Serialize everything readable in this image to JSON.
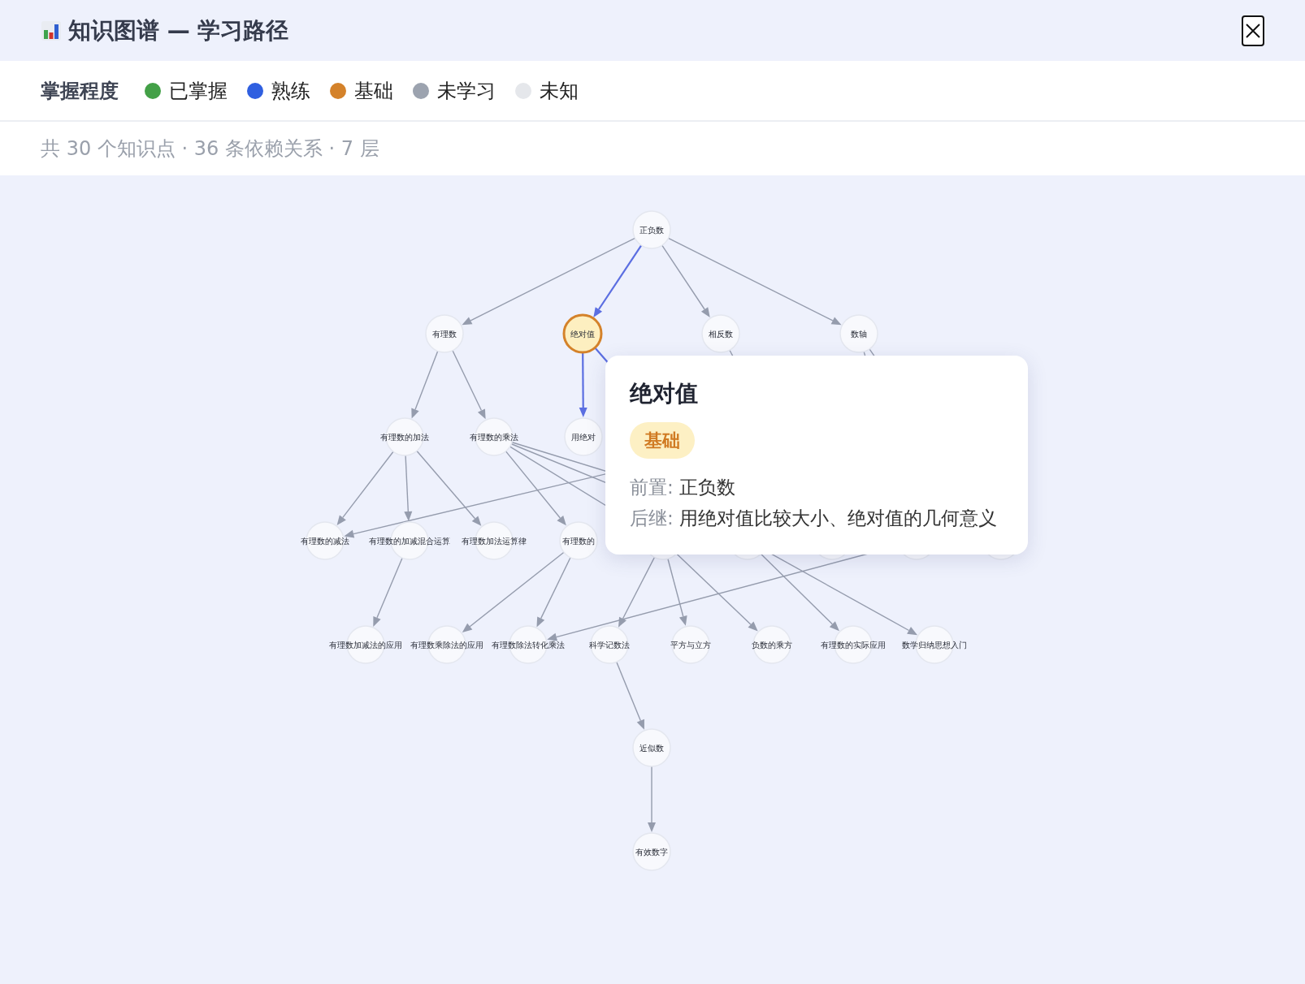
{
  "window": {
    "title": "知识图谱 — 学习路径"
  },
  "legend": {
    "title": "掌握程度",
    "items": [
      {
        "label": "已掌握",
        "color": "#43a047"
      },
      {
        "label": "熟练",
        "color": "#2f5fe0"
      },
      {
        "label": "基础",
        "color": "#d4822a"
      },
      {
        "label": "未学习",
        "color": "#9ca3af"
      },
      {
        "label": "未知",
        "color": "#e5e7eb"
      }
    ]
  },
  "stats": "共 30 个知识点 · 36 条依赖关系 · 7 层",
  "graph": {
    "layers": [
      {
        "nodes": [
          {
            "label": "正负数",
            "selected": false
          }
        ]
      },
      {
        "nodes": [
          {
            "label": "有理数",
            "selected": false
          },
          {
            "label": "绝对值",
            "selected": true
          },
          {
            "label": "相反数",
            "selected": false
          },
          {
            "label": "数轴",
            "selected": false
          }
        ]
      },
      {
        "nodes": [
          {
            "label": "有理数的加法",
            "selected": false
          },
          {
            "label": "有理数的乘法",
            "selected": false
          },
          {
            "label": "用绝对",
            "selected": false
          }
        ]
      },
      {
        "nodes": [
          {
            "label": "有理数的减法",
            "selected": false
          },
          {
            "label": "有理数的加减混合运算",
            "selected": false
          },
          {
            "label": "有理数加法运算律",
            "selected": false
          },
          {
            "label": "有理数的",
            "selected": false
          },
          {
            "selected": false
          },
          {
            "selected": false
          },
          {
            "selected": false
          },
          {
            "selected": false
          },
          {
            "selected": false
          }
        ]
      },
      {
        "nodes": [
          {
            "label": "有理数加减法的应用",
            "selected": false
          },
          {
            "label": "有理数乘除法的应用",
            "selected": false
          },
          {
            "label": "有理数除法转化乘法",
            "selected": false
          },
          {
            "label": "科学记数法",
            "selected": false
          },
          {
            "label": "平方与立方",
            "selected": false
          },
          {
            "label": "负数的乘方",
            "selected": false
          },
          {
            "label": "有理数的实际应用",
            "selected": false
          },
          {
            "label": "数学归纳思想入门",
            "selected": false
          }
        ]
      },
      {
        "nodes": [
          {
            "label": "近似数",
            "selected": false
          }
        ]
      },
      {
        "nodes": [
          {
            "label": "有效数字",
            "selected": false
          }
        ]
      }
    ],
    "edges": [
      {
        "highlighted": false
      },
      {
        "highlighted": true
      },
      {
        "highlighted": false
      },
      {
        "highlighted": false
      },
      {
        "highlighted": false
      },
      {
        "highlighted": false
      },
      {
        "highlighted": true
      },
      {
        "highlighted": true
      },
      {
        "highlighted": false
      },
      {
        "highlighted": false
      },
      {
        "highlighted": false
      },
      {
        "highlighted": false
      },
      {
        "highlighted": false
      },
      {
        "highlighted": false
      },
      {
        "highlighted": false
      },
      {
        "highlighted": false
      },
      {
        "highlighted": false
      },
      {
        "highlighted": false
      },
      {
        "highlighted": false
      },
      {
        "highlighted": false
      },
      {
        "highlighted": false
      },
      {
        "highlighted": false
      },
      {
        "highlighted": false
      },
      {
        "highlighted": false
      },
      {
        "highlighted": false
      },
      {
        "highlighted": false
      },
      {
        "highlighted": false
      },
      {
        "highlighted": false
      },
      {
        "highlighted": false
      },
      {
        "highlighted": false
      }
    ]
  },
  "tooltip": {
    "title": "绝对值",
    "badge": "基础",
    "lines": [
      {
        "label": "前置:",
        "value": "正负数"
      },
      {
        "label": "后继:",
        "value": "用绝对值比较大小、绝对值的几何意义"
      }
    ]
  }
}
